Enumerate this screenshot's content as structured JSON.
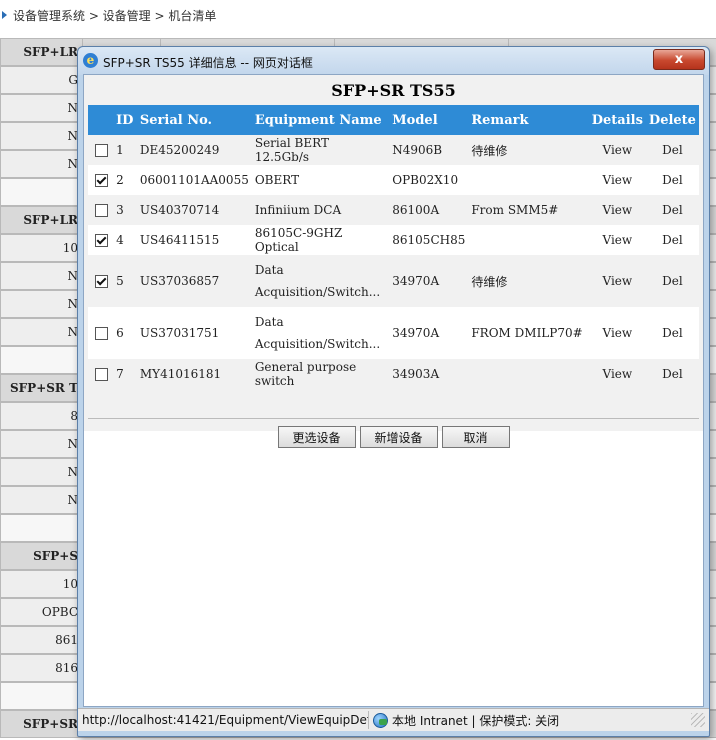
{
  "breadcrumb": "设备管理系统 > 设备管理 > 机台清单",
  "background_rows": [
    {
      "kind": "header",
      "cells": [
        "SFP+LR",
        "",
        "",
        "",
        ""
      ]
    },
    {
      "kind": "data",
      "cells": [
        "G",
        "",
        "",
        "",
        ""
      ]
    },
    {
      "kind": "data",
      "cells": [
        "N",
        "",
        "",
        "",
        ""
      ]
    },
    {
      "kind": "data",
      "cells": [
        "N",
        "",
        "",
        "",
        ""
      ]
    },
    {
      "kind": "data",
      "cells": [
        "N",
        "",
        "",
        "",
        ""
      ]
    },
    {
      "kind": "gap",
      "cells": [
        "",
        "",
        "",
        "",
        ""
      ]
    },
    {
      "kind": "header",
      "cells": [
        "SFP+LR",
        "",
        "",
        "",
        ""
      ]
    },
    {
      "kind": "data",
      "cells": [
        "10",
        "",
        "",
        "",
        ""
      ]
    },
    {
      "kind": "data",
      "cells": [
        "N",
        "",
        "",
        "",
        ""
      ]
    },
    {
      "kind": "data",
      "cells": [
        "N",
        "",
        "",
        "",
        ""
      ]
    },
    {
      "kind": "data",
      "cells": [
        "N",
        "",
        "",
        "",
        ""
      ]
    },
    {
      "kind": "gap",
      "cells": [
        "",
        "",
        "",
        "",
        ""
      ]
    },
    {
      "kind": "header",
      "cells": [
        "SFP+SR T",
        "",
        "",
        "",
        ""
      ]
    },
    {
      "kind": "data",
      "cells": [
        "8",
        "",
        "",
        "",
        ""
      ]
    },
    {
      "kind": "data",
      "cells": [
        "N",
        "",
        "",
        "",
        ""
      ]
    },
    {
      "kind": "data",
      "cells": [
        "N",
        "",
        "",
        "",
        ""
      ]
    },
    {
      "kind": "data",
      "cells": [
        "N",
        "",
        "",
        "",
        ""
      ]
    },
    {
      "kind": "gap",
      "cells": [
        "",
        "",
        "",
        "",
        ""
      ]
    },
    {
      "kind": "header",
      "cells": [
        "SFP+S",
        "",
        "",
        "",
        ""
      ]
    },
    {
      "kind": "data",
      "cells": [
        "10",
        "",
        "",
        "",
        ""
      ]
    },
    {
      "kind": "data",
      "cells": [
        "OPBC",
        "",
        "",
        "",
        ""
      ]
    },
    {
      "kind": "data",
      "cells": [
        "861",
        "",
        "",
        "",
        ""
      ]
    },
    {
      "kind": "data",
      "cells": [
        "816",
        "",
        "",
        "",
        ""
      ]
    },
    {
      "kind": "gap",
      "cells": [
        "",
        "",
        "",
        "",
        ""
      ]
    },
    {
      "kind": "header",
      "cells": [
        "SFP+SR",
        "",
        "",
        "",
        ""
      ]
    }
  ],
  "dialog": {
    "title": "SFP+SR TS55 详细信息 -- 网页对话框",
    "close_label": "x",
    "heading": "SFP+SR TS55",
    "columns": [
      "ID",
      "Serial No.",
      "Equipment Name",
      "Model",
      "Remark",
      "Details",
      "Delete"
    ],
    "rows": [
      {
        "checked": false,
        "id": "1",
        "serial": "DE45200249",
        "name": "Serial BERT 12.5Gb/s",
        "name2": "",
        "model": "N4906B",
        "remark": "待维修",
        "details": "View",
        "delete": "Del"
      },
      {
        "checked": true,
        "id": "2",
        "serial": "06001101AA0055",
        "name": "OBERT",
        "name2": "",
        "model": "OPB02X10",
        "remark": "",
        "details": "View",
        "delete": "Del"
      },
      {
        "checked": false,
        "id": "3",
        "serial": "US40370714",
        "name": "Infiniium DCA",
        "name2": "",
        "model": "86100A",
        "remark": "From SMM5#",
        "details": "View",
        "delete": "Del"
      },
      {
        "checked": true,
        "id": "4",
        "serial": "US46411515",
        "name": "86105C-9GHZ Optical",
        "name2": "",
        "model": "86105CH85",
        "remark": "",
        "details": "View",
        "delete": "Del"
      },
      {
        "checked": true,
        "id": "5",
        "serial": "US37036857",
        "name": "Data",
        "name2": "Acquisition/Switch...",
        "model": "34970A",
        "remark": "待维修",
        "details": "View",
        "delete": "Del"
      },
      {
        "checked": false,
        "id": "6",
        "serial": "US37031751",
        "name": "Data",
        "name2": "Acquisition/Switch...",
        "model": "34970A",
        "remark": "FROM DMILP70#",
        "details": "View",
        "delete": "Del"
      },
      {
        "checked": false,
        "id": "7",
        "serial": "MY41016181",
        "name": "General purpose switch",
        "name2": "",
        "model": "34903A",
        "remark": "",
        "details": "View",
        "delete": "Del"
      }
    ],
    "buttons": {
      "change": "更选设备",
      "add": "新增设备",
      "cancel": "取消"
    },
    "status": {
      "url": "http://localhost:41421/Equipment/ViewEquipDeta",
      "zone": "本地 Intranet | 保护模式: 关闭",
      "zone_icon": "globe-icon"
    }
  }
}
